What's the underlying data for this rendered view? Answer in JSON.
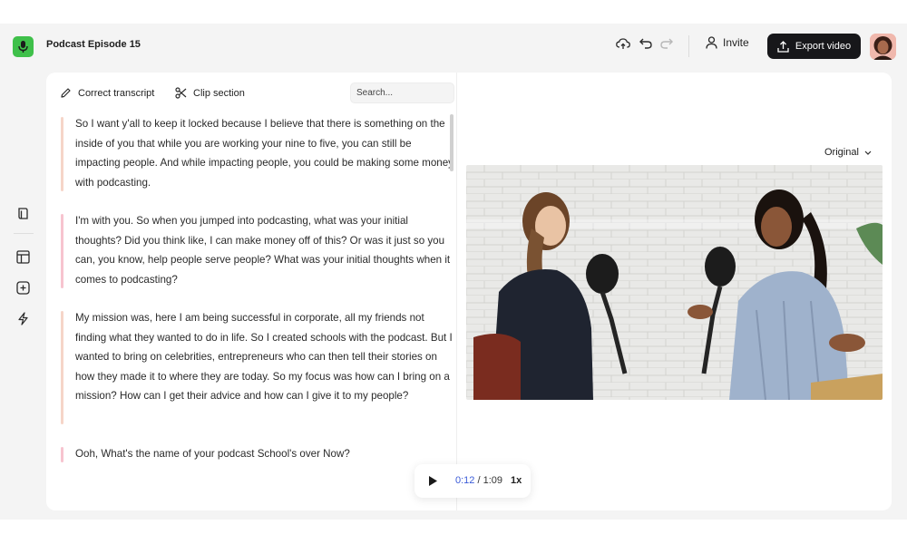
{
  "header": {
    "episode_title": "Podcast Episode 15",
    "invite_label": "Invite",
    "export_label": "Export video"
  },
  "toolbar": {
    "correct_transcript_label": "Correct transcript",
    "clip_section_label": "Clip section",
    "search_placeholder": "Search..."
  },
  "transcript": {
    "paragraphs": [
      {
        "text": "So I want y'all to keep it locked because I believe that there is something on the inside of you that while you are working your nine to five, you can still be impacting people. And while impacting people, you could be making some money with podcasting.",
        "bar_color": "#f6d5c8"
      },
      {
        "text": "I'm with you. So when you jumped into podcasting, what was your initial thoughts? Did you think like, I can make money off of this? Or was it just so you can, you know, help people serve people? What was your initial thoughts when it comes to podcasting?",
        "bar_color": "#f7c4cf"
      },
      {
        "text": "My mission was, here I am being successful in corporate, all my friends not finding what they wanted to do in life. So I created schools with the podcast. But I wanted to bring on celebrities, entrepreneurs who can then tell their stories on how they made it to where they are today. So my focus was how can I bring on a mission? How can I get their advice and how can I give it to my people?",
        "bar_color": "#f6d5c8"
      },
      {
        "text": "Ooh, What's the name of your podcast School's over Now?",
        "bar_color": "#f7c4cf"
      }
    ]
  },
  "video": {
    "quality_label": "Original"
  },
  "player": {
    "current_time": "0:12",
    "separator": " / ",
    "duration": "1:09",
    "speed": "1x"
  },
  "icons": {
    "logo": "microphone-icon",
    "cloud": "cloud-sync-icon",
    "undo": "undo-icon",
    "redo": "redo-icon",
    "person": "person-icon",
    "upload": "upload-icon",
    "pencil": "pencil-icon",
    "scissors": "scissors-icon",
    "sidebar": [
      "layers-icon",
      "layout-icon",
      "add-square-icon",
      "lightning-icon"
    ],
    "play": "play-icon",
    "chevron": "chevron-down-icon"
  },
  "colors": {
    "brand_green": "#3fc04a",
    "export_button": "#17171a",
    "time_accent": "#3a5bd8"
  }
}
